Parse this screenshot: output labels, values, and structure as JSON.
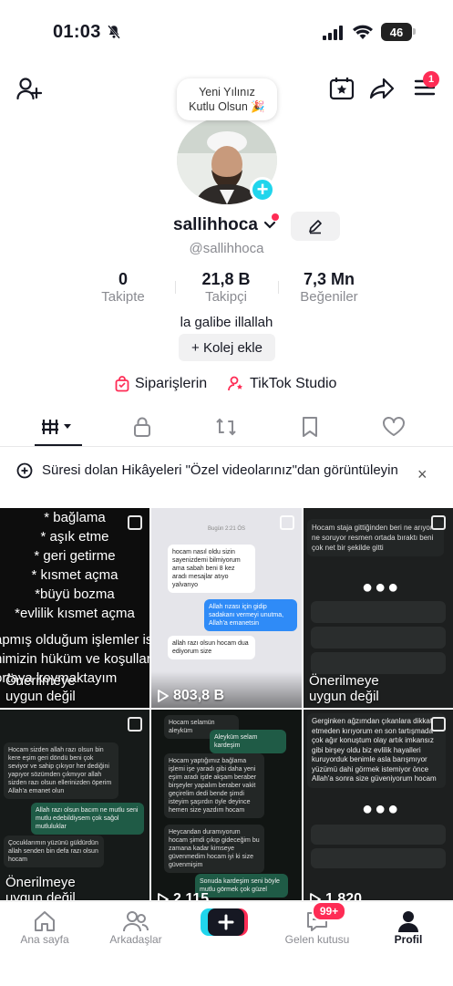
{
  "status_bar": {
    "time": "01:03",
    "battery": "46"
  },
  "header": {
    "notification_count": "1",
    "bubble_line1": "Yeni Yılınız",
    "bubble_line2": "Kutlu Olsun 🎉"
  },
  "profile": {
    "username": "sallihhoca",
    "handle": "@sallihhoca",
    "stats": [
      {
        "value": "0",
        "label": "Takipte"
      },
      {
        "value": "21,8 B",
        "label": "Takipçi"
      },
      {
        "value": "7,3 Mn",
        "label": "Beğeniler"
      }
    ],
    "bio": "la galibe illallah",
    "add_college": "+ Kolej ekle",
    "orders": "Siparişlerin",
    "studio": "TikTok Studio"
  },
  "notice": {
    "text": "Süresi dolan Hikâyeleri \"Özel videolarınız\"dan görüntüleyin",
    "close": "×"
  },
  "grid": {
    "spell_lines": [
      "* bağlama",
      "* aşık etme",
      "* geri getirme",
      "* kısmet açma",
      "*büyü bozma",
      "*evlilik kısmet açma"
    ],
    "spell_tail": [
      "apmış olduğum işlemler isla",
      "nimizin hüküm ve koşullarını",
      "ortaya koymaktayım"
    ],
    "not_eligible": "Önerilmeye uygun değil",
    "views_1": "803,8 B",
    "views_2": "2.115",
    "views_3": "1.820",
    "chat_date": "Bugün 2:21 ÖS",
    "chat_msgs": [
      "hocam nasıl oldu sizin sayenizdemi bilmiyorum ama sabah beni 8 kez aradı mesajlar atıyo yalvarıyo",
      "Allah rızası için gidip sadakanı vermeyi unutma, Allah'a emanetsin",
      "allah razı olsun hocam dua ediyorum size"
    ],
    "cell3_text": "Hocam staja gittiğinden beri ne arıyor ne soruyor resmen ortada bıraktı beni çok net bir şekilde gitti",
    "cell6_text": "Gerginken ağzımdan çıkanlara dikkat etmeden kırıyorum en son tartışmada çok ağır konuştum olay artık imkansız gibi birşey oldu biz evlilik hayalleri kuruyorduk benimle asla barışmıyor yüzümü dahi görmek istemiyor önce Allah'a sonra size güveniyorum hocam",
    "cell5_msgs": [
      "Hocam selamün aleyküm",
      "Aleyküm selam kardeşim",
      "Hocam yaptığımız bağlama işlemi işe yaradı gibi daha yeni eşim aradı işde akşam beraber birşeyler yapalım beraber vakit geçirelim dedi bende şimdi isteyim şaşırdın öyle deyince hemen size yazdım hocam",
      "Heycandan duramıyorum hocam şimdi çıkıp gideceğim bu zamana kadar kimseye güvenmedim hocam iyi ki size güvenmişim",
      "Sonuda kardeşim seni böyle mutlu görmek çok güzel"
    ],
    "cell4_msgs": [
      "Hocam sizden allah razı olsun bin kere eşim geri döndü beni çok seviyor ve sahip çıkıyor her dediğini yapıyor sözümden çıkmıyor allah sizden razı olsun ellerinizden öperim Allah'a emanet olun",
      "Allah razı olsun bacım ne mutlu seni mutlu edebildiysem çok sağol mutluluklar",
      "Çocuklarımın yüzünü güldürdün allah senden bin defa razı olsun hocam"
    ]
  },
  "bottom_nav": {
    "home": "Ana sayfa",
    "friends": "Arkadaşlar",
    "inbox": "Gelen kutusu",
    "inbox_badge": "99+",
    "profile": "Profil"
  }
}
